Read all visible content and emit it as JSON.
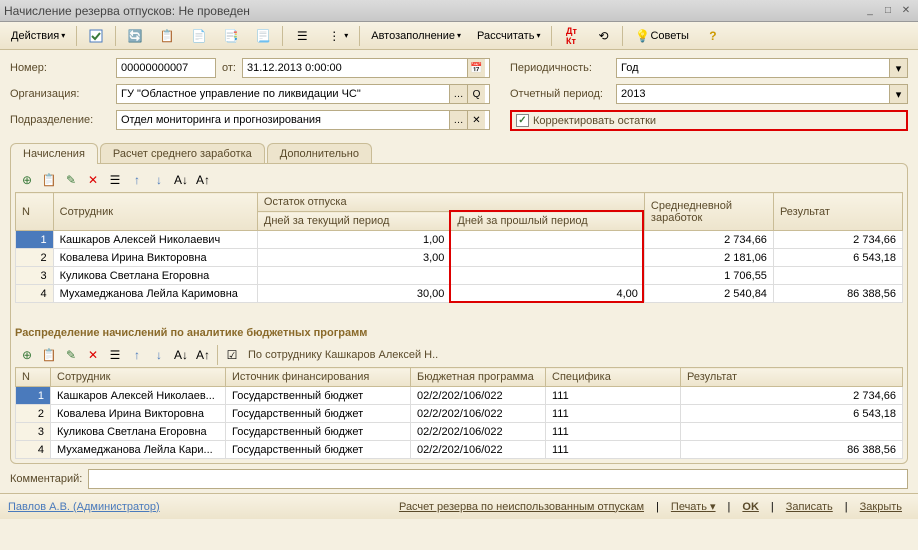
{
  "title": "Начисление резерва отпусков: Не проведен",
  "toolbar": {
    "actions": "Действия",
    "autofill": "Автозаполнение",
    "calculate": "Рассчитать",
    "tips": "Советы"
  },
  "form": {
    "number_label": "Номер:",
    "number": "00000000007",
    "from_label": "от:",
    "date": "31.12.2013 0:00:00",
    "org_label": "Организация:",
    "org": "ГУ \"Областное управление по ликвидации ЧС\"",
    "subdiv_label": "Подразделение:",
    "subdiv": "Отдел мониторинга и прогнозирования",
    "periodicity_label": "Периодичность:",
    "periodicity": "Год",
    "period_label": "Отчетный период:",
    "period": "2013",
    "correct_label": "Корректировать остатки"
  },
  "tabs": {
    "t1": "Начисления",
    "t2": "Расчет среднего заработка",
    "t3": "Дополнительно"
  },
  "table1": {
    "headers": {
      "n": "N",
      "employee": "Сотрудник",
      "balance": "Остаток отпуска",
      "days_current": "Дней за текущий период",
      "days_prev": "Дней за прошлый период",
      "avg_daily": "Среднедневной заработок",
      "result": "Результат"
    },
    "rows": [
      {
        "n": "1",
        "emp": "Кашкаров Алексей Николаевич",
        "dc": "1,00",
        "dp": "",
        "avg": "2 734,66",
        "res": "2 734,66"
      },
      {
        "n": "2",
        "emp": "Ковалева Ирина Викторовна",
        "dc": "3,00",
        "dp": "",
        "avg": "2 181,06",
        "res": "6 543,18"
      },
      {
        "n": "3",
        "emp": "Куликова Светлана Егоровна",
        "dc": "",
        "dp": "",
        "avg": "1 706,55",
        "res": ""
      },
      {
        "n": "4",
        "emp": "Мухамеджанова Лейла Каримовна",
        "dc": "30,00",
        "dp": "4,00",
        "avg": "2 540,84",
        "res": "86 388,56"
      }
    ]
  },
  "section2_title": "Распределение начислений по аналитике бюджетных программ",
  "filter_text": "По сотруднику Кашкаров Алексей Н..",
  "table2": {
    "headers": {
      "n": "N",
      "employee": "Сотрудник",
      "source": "Источник финансирования",
      "program": "Бюджетная программа",
      "spec": "Специфика",
      "result": "Результат"
    },
    "rows": [
      {
        "n": "1",
        "emp": "Кашкаров Алексей Николаев...",
        "src": "Государственный бюджет",
        "prog": "02/2/202/106/022",
        "spec": "111",
        "res": "2 734,66"
      },
      {
        "n": "2",
        "emp": "Ковалева Ирина Викторовна",
        "src": "Государственный бюджет",
        "prog": "02/2/202/106/022",
        "spec": "111",
        "res": "6 543,18"
      },
      {
        "n": "3",
        "emp": "Куликова Светлана Егоровна",
        "src": "Государственный бюджет",
        "prog": "02/2/202/106/022",
        "spec": "111",
        "res": ""
      },
      {
        "n": "4",
        "emp": "Мухамеджанова Лейла Кари...",
        "src": "Государственный бюджет",
        "prog": "02/2/202/106/022",
        "spec": "111",
        "res": "86 388,56"
      }
    ]
  },
  "comment_label": "Комментарий:",
  "status": {
    "user": "Павлов А.В. (Администратор)",
    "calc_unused": "Расчет резерва по неиспользованным отпускам",
    "print": "Печать",
    "ok": "OK",
    "save": "Записать",
    "close": "Закрыть"
  }
}
